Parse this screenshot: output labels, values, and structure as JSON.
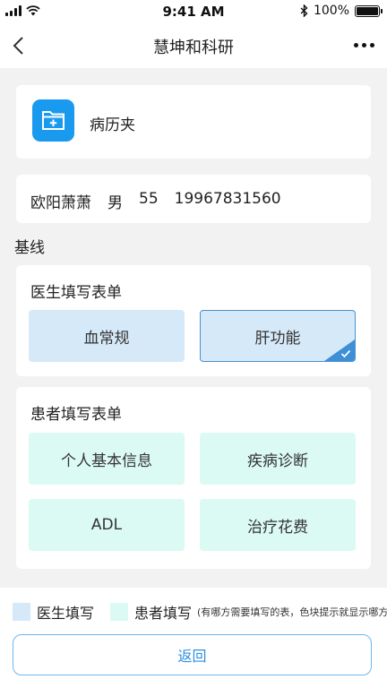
{
  "status_bar": {
    "time": "9:41 AM",
    "battery_text": "100%",
    "battery_level": 1.0
  },
  "nav": {
    "title": "慧坤和科研",
    "back_icon": "chevron-left-icon",
    "more_icon": "more-dots-icon"
  },
  "folder": {
    "label": "病历夹",
    "icon": "medical-folder-icon",
    "icon_color": "#1a9aef"
  },
  "patient": {
    "name": "欧阳萧萧",
    "gender": "男",
    "age": "55",
    "phone": "19967831560"
  },
  "baseline": {
    "title": "基线"
  },
  "doctor_forms": {
    "title": "医生填写表单",
    "items": [
      {
        "label": "血常规",
        "selected": false
      },
      {
        "label": "肝功能",
        "selected": true
      }
    ]
  },
  "patient_forms": {
    "title": "患者填写表单",
    "items": [
      {
        "label": "个人基本信息"
      },
      {
        "label": "疾病诊断"
      },
      {
        "label": "ADL"
      },
      {
        "label": "治疗花费"
      }
    ]
  },
  "legend": {
    "doctor_label": "医生填写",
    "patient_label": "患者填写",
    "note": "(有哪方需要填写的表，色块提示就显示哪方)",
    "doctor_color": "#d6e9f8",
    "patient_color": "#dbfaf3"
  },
  "footer": {
    "back_label": "返回"
  },
  "colors": {
    "accent": "#2d8fe0",
    "selected_corner": "#3d8fd6"
  }
}
